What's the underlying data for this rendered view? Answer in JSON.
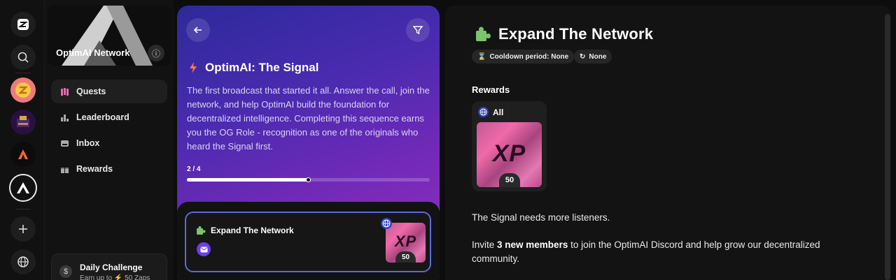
{
  "rail": {
    "items": [
      {
        "name": "zealy-logo-icon"
      },
      {
        "name": "search-icon"
      },
      {
        "name": "community-avatar-1"
      },
      {
        "name": "community-avatar-2"
      },
      {
        "name": "community-avatar-3"
      },
      {
        "name": "community-avatar-optimai"
      },
      {
        "name": "add-community-icon"
      },
      {
        "name": "globe-icon"
      }
    ]
  },
  "sidebar": {
    "community_name": "OptimAI Network",
    "info_icon": "info-icon",
    "items": [
      {
        "label": "Quests",
        "icon": "map-icon",
        "active": true
      },
      {
        "label": "Leaderboard",
        "icon": "bar-chart-icon",
        "active": false
      },
      {
        "label": "Inbox",
        "icon": "inbox-icon",
        "active": false
      },
      {
        "label": "Rewards",
        "icon": "gift-icon",
        "active": false
      }
    ],
    "daily": {
      "title": "Daily Challenge",
      "subtitle": "Earn up to ⚡ 50 Zaps"
    }
  },
  "module": {
    "title": "OptimAI: The Signal",
    "description": "The first broadcast that started it all. Answer the call, join the network, and help OptimAI build the foundation for decentralized intelligence. Completing this sequence earns you the OG Role - recognition as one of the originals who heard the Signal first.",
    "progress_label": "2 / 4",
    "progress_fraction": 0.5,
    "quest_card": {
      "title": "Expand The Network",
      "xp_text": "XP",
      "xp_value": "50"
    }
  },
  "detail": {
    "title": "Expand The Network",
    "chips": [
      "Cooldown period: None",
      "None"
    ],
    "rewards_heading": "Rewards",
    "reward": {
      "audience": "All",
      "xp_text": "XP",
      "xp_value": "50"
    },
    "para1": "The Signal needs more listeners.",
    "para2_pre": "Invite ",
    "para2_bold": "3 new members",
    "para2_post": " to join the OptimAI Discord and help grow our decentralized community."
  },
  "colors": {
    "accent": "#5b6ad6",
    "gradient_start": "#2d2a9a",
    "gradient_end": "#8e36b8",
    "mail": "#6d3cf0"
  }
}
